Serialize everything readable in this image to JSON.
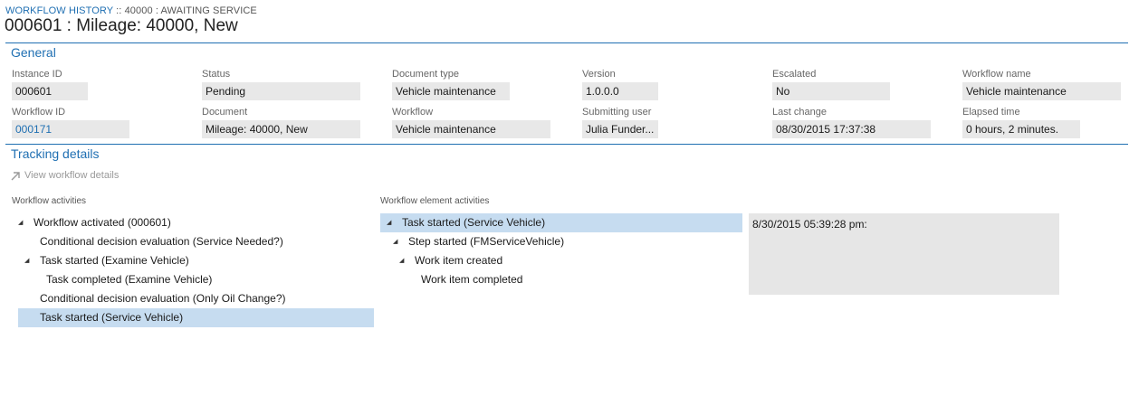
{
  "header": {
    "breadcrumb_link": "WORKFLOW HISTORY",
    "breadcrumb_rest": " :: 40000 : AWAITING SERVICE",
    "title": "000601 : Mileage: 40000, New"
  },
  "general": {
    "section_title": "General",
    "fields": {
      "instance_id": {
        "label": "Instance ID",
        "value": "000601"
      },
      "status": {
        "label": "Status",
        "value": "Pending"
      },
      "document_type": {
        "label": "Document type",
        "value": "Vehicle maintenance"
      },
      "version": {
        "label": "Version",
        "value": "1.0.0.0"
      },
      "escalated": {
        "label": "Escalated",
        "value": "No"
      },
      "workflow_name": {
        "label": "Workflow name",
        "value": "Vehicle maintenance"
      },
      "workflow_id": {
        "label": "Workflow ID",
        "value": "000171"
      },
      "document": {
        "label": "Document",
        "value": "Mileage: 40000, New"
      },
      "workflow": {
        "label": "Workflow",
        "value": "Vehicle maintenance"
      },
      "submitting_user": {
        "label": "Submitting user",
        "value": "Julia Funder..."
      },
      "last_change": {
        "label": "Last change",
        "value": "08/30/2015 17:37:38"
      },
      "elapsed_time": {
        "label": "Elapsed time",
        "value": "0 hours, 2 minutes."
      }
    }
  },
  "tracking": {
    "section_title": "Tracking details",
    "view_details_label": "View workflow details",
    "workflow_activities": {
      "heading": "Workflow activities",
      "items": [
        {
          "label": "Workflow activated (000601)",
          "expanded": true
        },
        {
          "label": "Conditional decision evaluation (Service Needed?)"
        },
        {
          "label": "Task started (Examine Vehicle)",
          "expanded": true
        },
        {
          "label": "Task completed (Examine Vehicle)"
        },
        {
          "label": "Conditional decision evaluation (Only Oil Change?)"
        },
        {
          "label": "Task started (Service Vehicle)",
          "selected": true
        }
      ]
    },
    "element_activities": {
      "heading": "Workflow element activities",
      "items": [
        {
          "label": "Task started (Service Vehicle)",
          "expanded": true,
          "selected": true
        },
        {
          "label": "Step started (FMServiceVehicle)",
          "expanded": true
        },
        {
          "label": "Work item created",
          "expanded": true
        },
        {
          "label": "Work item completed"
        }
      ]
    },
    "detail_text": "8/30/2015 05:39:28 pm:"
  },
  "colors": {
    "accent": "#1f6fb2",
    "selected_row": "#c6dcf0",
    "field_bg": "#e8e8e8"
  }
}
